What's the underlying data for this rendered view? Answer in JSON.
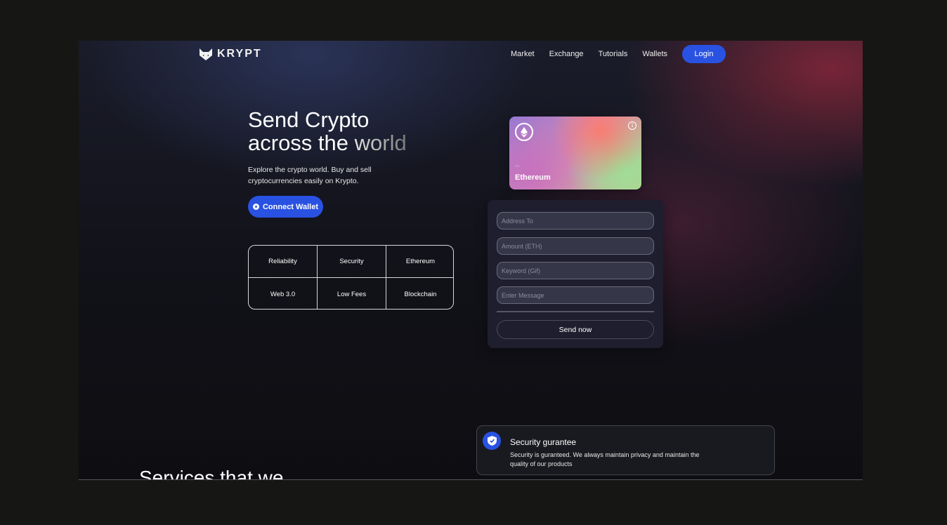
{
  "nav": {
    "logo_text": "KRYPT",
    "links": [
      "Market",
      "Exchange",
      "Tutorials",
      "Wallets"
    ],
    "login_label": "Login"
  },
  "hero": {
    "title_line1": "Send Crypto",
    "title_line2": "across the world",
    "description": "Explore the crypto world. Buy and sell cryptocurrencies easily on Krypto.",
    "connect_label": "Connect Wallet"
  },
  "features": [
    "Reliability",
    "Security",
    "Ethereum",
    "Web 3.0",
    "Low Fees",
    "Blockchain"
  ],
  "card": {
    "address": "...",
    "network": "Ethereum",
    "icon": "ethereum-icon"
  },
  "form": {
    "address_placeholder": "Address To",
    "amount_placeholder": "Amount (ETH)",
    "keyword_placeholder": "Keyword (Gif)",
    "message_placeholder": "Enter Message",
    "send_label": "Send now"
  },
  "services": {
    "title": "Services that we",
    "card_title": "Security gurantee",
    "card_desc": "Security is guranteed. We always maintain privacy and maintain the quality of our products",
    "icon": "shield-icon"
  },
  "colors": {
    "accent": "#2952e3",
    "panel": "#1e1e2e"
  }
}
